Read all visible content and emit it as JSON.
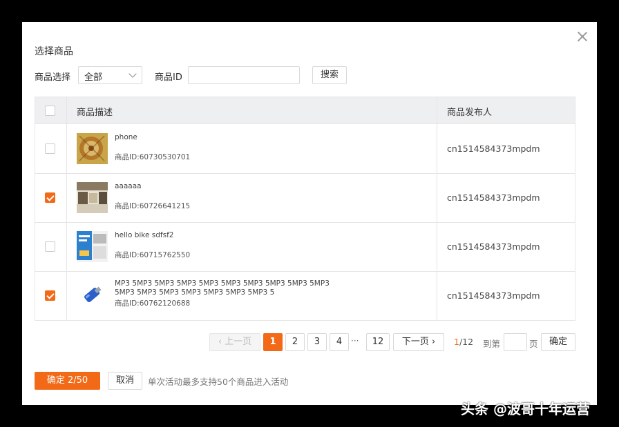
{
  "dialog": {
    "title": "选择商品",
    "close_icon": "close-icon"
  },
  "filters": {
    "category_label": "商品选择",
    "category_value": "全部",
    "id_label": "商品ID",
    "id_value": "",
    "search_label": "搜索"
  },
  "table": {
    "headers": {
      "description": "商品描述",
      "publisher": "商品发布人"
    },
    "rows": [
      {
        "checked": false,
        "name": "phone",
        "id": "商品ID:60730530701",
        "publisher": "cn1514584373mpdm"
      },
      {
        "checked": true,
        "name": "aaaaaa",
        "id": "商品ID:60726641215",
        "publisher": "cn1514584373mpdm"
      },
      {
        "checked": false,
        "name": "hello bike sdfsf2",
        "id": "商品ID:60715762550",
        "publisher": "cn1514584373mpdm"
      },
      {
        "checked": true,
        "name": "MP3 5MP3 5MP3 5MP3 5MP3 5MP3 5MP3 5MP3 5MP3 5MP3 5MP3 5MP3 5MP3 5MP3 5MP3 5MP3 5MP3 5",
        "id": "商品ID:60762120688",
        "publisher": "cn1514584373mpdm"
      }
    ]
  },
  "pagination": {
    "prev_label": "上一页",
    "pages": [
      "1",
      "2",
      "3",
      "4"
    ],
    "ellipsis": "···",
    "last_page": "12",
    "next_label": "下一页",
    "current": "1",
    "total": "/12",
    "goto_label": "到第",
    "goto_suffix": "页",
    "goto_value": "",
    "confirm_label": "确定"
  },
  "footer": {
    "confirm_label": "确定 2/50",
    "cancel_label": "取消",
    "note": "单次活动最多支持50个商品进入活动"
  },
  "watermark": "头条 @波哥十年运营",
  "colors": {
    "accent": "#f26a17",
    "header_bg": "#eeeff1",
    "border": "#e5e5e5"
  }
}
